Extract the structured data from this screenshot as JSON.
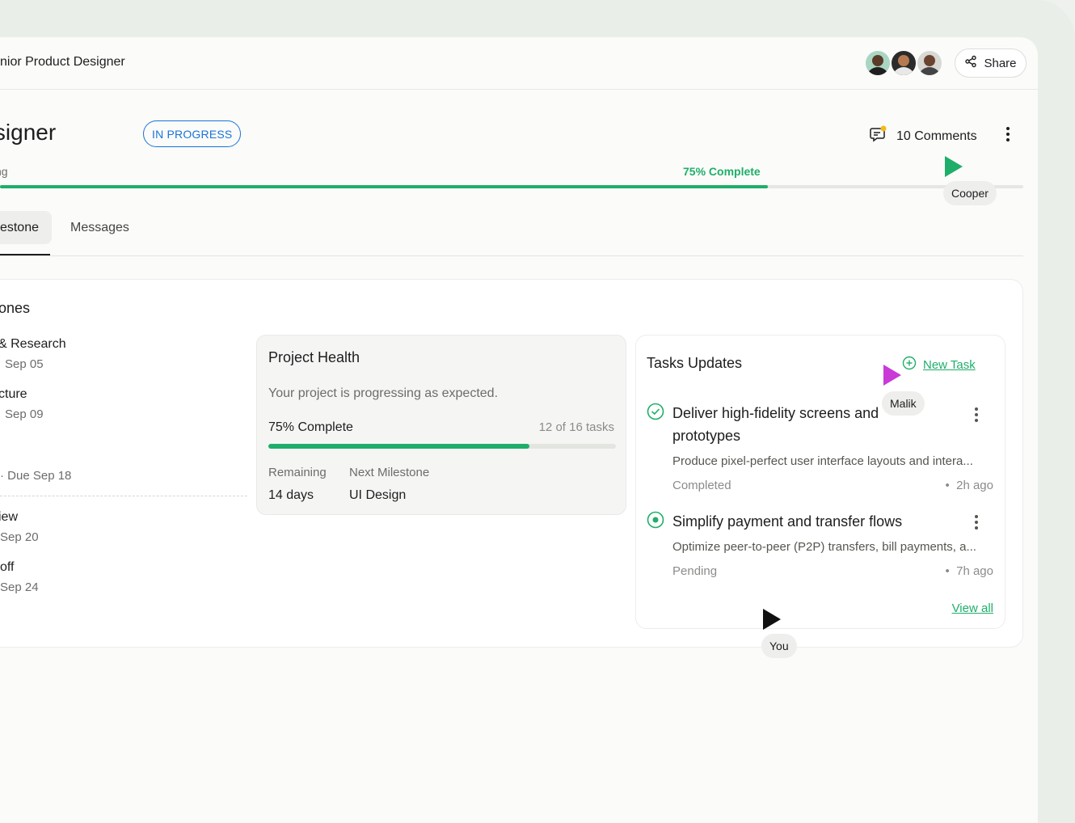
{
  "header": {
    "breadcrumb": "nior Product Designer",
    "share_label": "Share",
    "title": "uct Designer",
    "status_badge": "IN PROGRESS",
    "comments_label": "10 Comments",
    "progress_left_label": "ng",
    "progress_label": "75% Complete",
    "progress_value": 0.75
  },
  "tabs": {
    "active_label": "estone",
    "messages_label": "Messages"
  },
  "milestones": {
    "title": "ones",
    "items": [
      {
        "name": "& Research",
        "due": "Sep 05"
      },
      {
        "name": "cture",
        "due": "Sep 09"
      },
      {
        "name": "",
        "due": "· Due Sep 18"
      },
      {
        "name": "iew",
        "due": "Sep 20"
      },
      {
        "name": "off",
        "due": "Sep 24"
      }
    ]
  },
  "project_health": {
    "title": "Project Health",
    "description": "Your project is progressing as expected.",
    "percent_label": "75% Complete",
    "tasks_label": "12 of 16 tasks",
    "progress_value": 0.75,
    "remaining_label": "Remaining",
    "remaining_value": "14 days",
    "next_label": "Next Milestone",
    "next_value": "UI Design"
  },
  "tasks": {
    "title": "Tasks Updates",
    "new_task_label": "New Task",
    "view_all_label": "View all",
    "items": [
      {
        "title": "Deliver high-fidelity screens and prototypes",
        "description": "Produce pixel-perfect user interface layouts and intera...",
        "status": "Completed",
        "time": "2h ago"
      },
      {
        "title": "Simplify payment and transfer flows",
        "description": "Optimize peer-to-peer (P2P) transfers, bill payments, a...",
        "status": "Pending",
        "time": "7h ago"
      }
    ]
  },
  "cursors": {
    "cooper": {
      "label": "Cooper",
      "color": "#1fae6a"
    },
    "malik": {
      "label": "Malik",
      "color": "#c93ad6"
    },
    "you": {
      "label": "You",
      "color": "#111111"
    }
  },
  "colors": {
    "accent": "#1fae6a",
    "badge": "#1a73d9"
  }
}
